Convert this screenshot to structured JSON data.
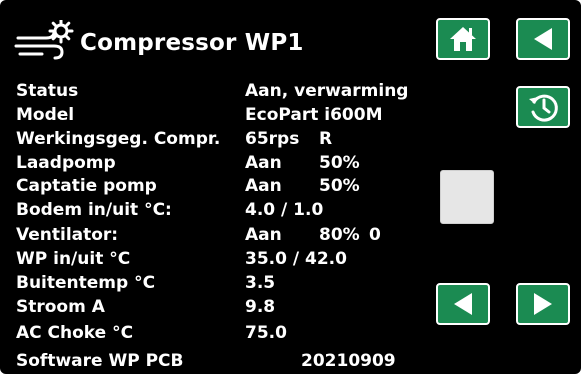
{
  "header": {
    "title": "Compressor WP1",
    "icon": "compressor-fan-icon"
  },
  "rows": [
    {
      "label": "Status",
      "v1": "Aan, verwarming"
    },
    {
      "label": "Model",
      "v1": "EcoPart i600M"
    },
    {
      "label": "Werkingsgeg. Compr.",
      "v1": "65rps",
      "v2": "R"
    },
    {
      "label": "Laadpomp",
      "v1": "Aan",
      "v2": "50%"
    },
    {
      "label": "Captatie pomp",
      "v1": "Aan",
      "v2": "50%"
    },
    {
      "label": "Bodem in/uit °C:",
      "v1": "4.0 / 1.0"
    },
    {
      "label": "Ventilator:",
      "v1": "Aan",
      "v2": "80%",
      "v3": "0"
    },
    {
      "label": "WP in/uit °C",
      "v1": "35.0 / 42.0"
    },
    {
      "label": "Buitentemp °C",
      "v1": "3.5"
    },
    {
      "label": "Stroom A",
      "v1": "9.8"
    },
    {
      "label": "AC Choke °C",
      "v1": "75.0"
    },
    {
      "label": "Software WP PCB",
      "v_wide": "20210909"
    }
  ],
  "buttons": {
    "home": "home-icon",
    "back": "back-arrow-icon",
    "history": "history-icon",
    "prev": "previous-icon",
    "next": "next-icon"
  },
  "colors": {
    "background": "#000000",
    "text": "#ffffff",
    "button_green": "#1b8b52",
    "scroll_thumb": "#e6e6e6"
  }
}
